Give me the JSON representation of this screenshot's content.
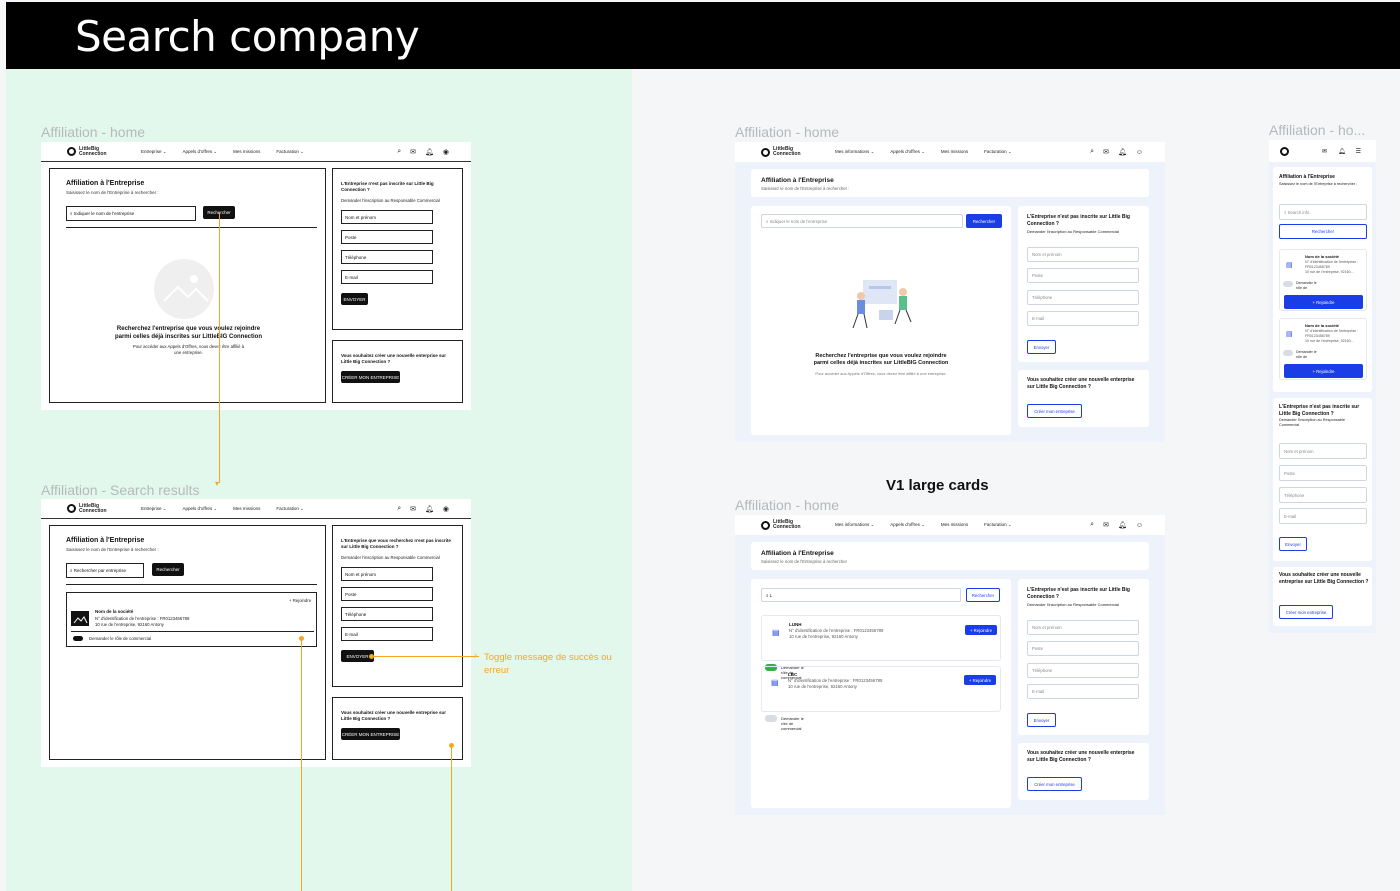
{
  "header": {
    "title": "Search company"
  },
  "labels": {
    "wf_home": "Affiliation - home",
    "wf_results": "Affiliation - Search results",
    "v1_top": "Affiliation - home",
    "v1_bottom": "Affiliation - home",
    "mobile": "Affiliation - ho...",
    "v1_large": "V1 large cards",
    "toggle_note": "Toggle message de succès ou erreur"
  },
  "nav": {
    "logo_line1": "LittleBig",
    "logo_line2": "Connection",
    "wf_items": [
      "Entreprise ⌄",
      "Appels d'offres ⌄",
      "Mes missions",
      "Facturation ⌄"
    ],
    "v1_items": [
      "Mes informations ⌄",
      "Appels d'offres ⌄",
      "Mes missions",
      "Facturation ⌄"
    ]
  },
  "wf_home": {
    "title": "Affiliation à l'Entreprise",
    "subtitle": "Saisissez le nom de l'Entreprise à rechercher :",
    "search_placeholder": "Indiquer le nom de l'entreprise",
    "search_button": "Rechercher",
    "empty_title_1": "Recherchez l'entreprise que vous voulez rejoindre",
    "empty_title_2": "parmi celles déjà inscrites sur LittleBIG Connection",
    "empty_sub_1": "Pour accéder aux Appels d'Offres, vous devez être affilié à",
    "empty_sub_2": "une entreprise.",
    "side_title": "L'Entreprise n'est pas inscrite sur Little Big Connection ?",
    "side_sub": "Demander l'inscription au Responsable Commercial",
    "fields": [
      "Nom et prénom",
      "Poste",
      "Téléphone",
      "E-mail"
    ],
    "send_button": "ENVOYER",
    "create_title": "Vous souhaitez créer une nouvelle enterprise sur Little Big Connection ?",
    "create_button": "CRÉER MON ENTREPRISE"
  },
  "wf_results": {
    "title": "Affiliation à l'Entreprise",
    "subtitle": "Saisissez le nom de l'Entreprise à rechercher :",
    "search_placeholder": "Rechercher par entreprise",
    "search_button": "Rechercher",
    "join": "+ Rejoindre",
    "company_name": "Nom de la société",
    "company_id": "N° d'identification de l'entreprise : FR0123456789",
    "company_address": "10 rue de l'entreprise, 92160 Antony",
    "toggle_label": "Demander le rôle de commercial",
    "side_title": "L'Entreprise que vous recherchez n'est pas inscrite sur Little Big Connection ?",
    "side_sub": "Demander l'inscription au Responsable Commercial",
    "fields": [
      "Nom et prénom",
      "Poste",
      "Téléphone",
      "E-mail"
    ],
    "send_button": "ENVOYER",
    "create_title": "Vous souhaitez créer une nouvelle entreprise sur Little Big Connection ?",
    "create_button": "CRÉER MON ENTREPRISE"
  },
  "v1_home": {
    "title": "Affiliation à l'Entreprise",
    "subtitle": "Saisissez le nom de l'Entreprise à rechercher :",
    "search_placeholder": "Indiquer le nom de l'entreprise",
    "search_button": "Rechercher",
    "empty_title_1": "Recherchez l'entreprise que vous voulez rejoindre",
    "empty_title_2": "parmi celles déjà inscrites sur LittleBIG Connection",
    "empty_sub": "Pour accéder aux Appels d'Offres, vous devez être affilié à une entreprise.",
    "side_title": "L'Entreprise n'est pas inscrite sur Little Big Connection ?",
    "side_sub": "Demander l'inscription au Responsable Commercial",
    "fields": [
      "Nom et prénom",
      "Poste",
      "Téléphone",
      "E-mail"
    ],
    "send_button": "Envoyer",
    "create_title": "Vous souhaitez créer une nouvelle enterprise sur Little Big Connection ?",
    "create_button": "Créer mon entreprise"
  },
  "v1_large": {
    "title": "Affiliation à l'Entreprise",
    "subtitle": "Saisissez le nom de l'Entreprise à rechercher",
    "search_value": "L",
    "search_button": "Rechercher",
    "results": [
      {
        "name": "LUNH",
        "id": "N° d'identification de l'entreprise : FR0123456789",
        "address": "10 rue de l'entreprise, 92160 Antony",
        "join": "+ Rejoindre",
        "toggle": "Demander le rôle de commercial",
        "on": true
      },
      {
        "name": "LBC",
        "id": "N° d'identification de l'entreprise : FR0123456789",
        "address": "10 rue de l'entreprise, 92160 Antony",
        "join": "+ Rejoindre",
        "toggle": "Demander le rôle de commercial",
        "on": false
      }
    ],
    "side_title": "L'Entreprise n'est pas inscrite sur Little Big Connection ?",
    "side_sub": "Demander l'inscription au Responsable Commercial",
    "fields": [
      "Nom et prénom",
      "Poste",
      "Téléphone",
      "E-mail"
    ],
    "send_button": "Envoyer",
    "create_title": "Vous souhaitez créer une nouvelle enterprise sur Little Big Connection ?",
    "create_button": "Créer mon entreprise"
  },
  "mobile": {
    "title": "Affiliation à l'Entreprise",
    "subtitle": "Saisissez le nom de l'Entreprise à rechercher :",
    "search_placeholder": "Search info",
    "search_button": "Rechercher",
    "card_name": "Nom de la société",
    "card_id": "N° d'identification de l'entreprise : FR0123456789",
    "card_address": "10 rue de l'entreprise, 92160...",
    "toggle_label": "Demander le rôle de",
    "join": "+ Rejoindre",
    "side_title": "L'Entreprise n'est pas inscrite sur Little Big Connection ?",
    "side_sub": "Demander l'inscription au Responsable Commercial",
    "fields": [
      "Nom et prénom",
      "Poste",
      "Téléphone",
      "E-mail"
    ],
    "send_button": "Envoyer",
    "create_title": "Vous souhaitez créer une nouvelle entreprise sur Little Big Connection ?",
    "create_button": "Créer mon entreprise"
  },
  "colors": {
    "accent": "#1a3de6",
    "annotation": "#f5a623",
    "green_bg": "#e3f8ec"
  }
}
